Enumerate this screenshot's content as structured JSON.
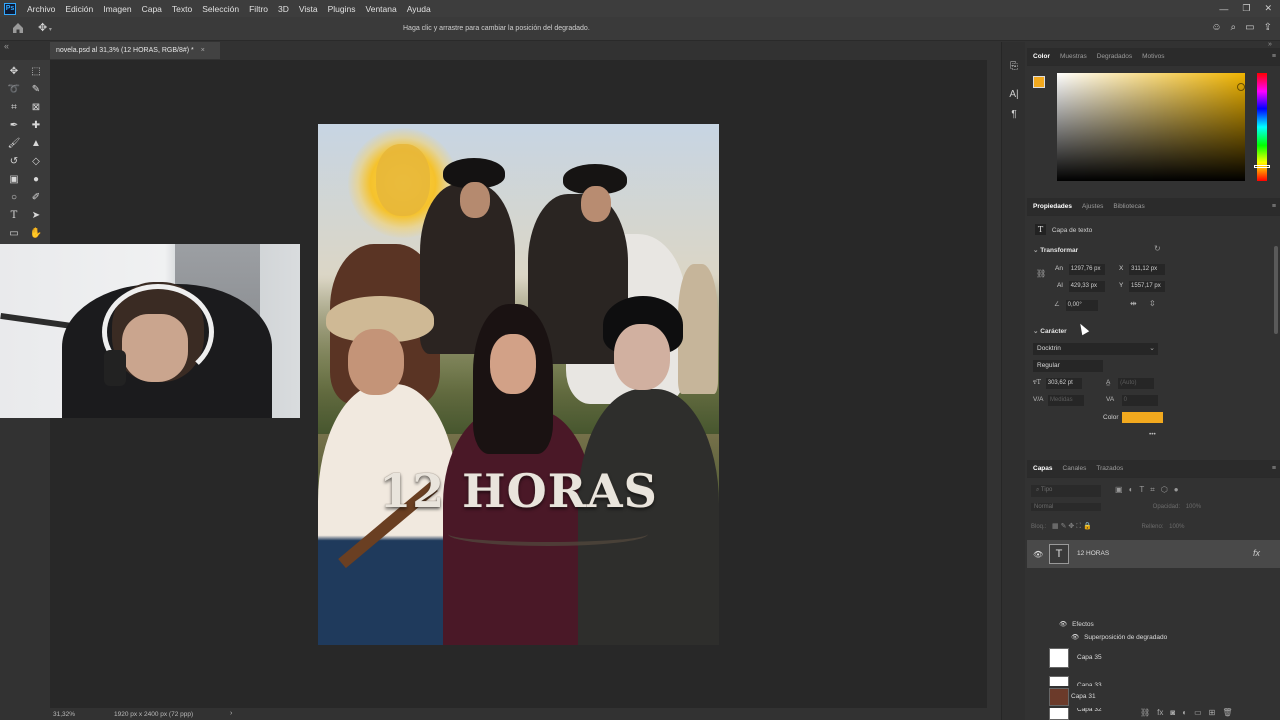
{
  "menu": [
    "Archivo",
    "Edición",
    "Imagen",
    "Capa",
    "Texto",
    "Selección",
    "Filtro",
    "3D",
    "Vista",
    "Plugins",
    "Ventana",
    "Ayuda"
  ],
  "app_logo": "Ps",
  "options_bar": {
    "hint": "Haga clic y arrastre para cambiar la posición del degradado."
  },
  "document": {
    "tab_title": "novela.psd al 31,3% (12 HORAS, RGB/8#) *"
  },
  "poster": {
    "title": "12 HORAS"
  },
  "status": {
    "zoom": "31,32%",
    "size": "1920 px x 2400 px (72 ppp)"
  },
  "color_panel": {
    "tabs": [
      "Color",
      "Muestras",
      "Degradados",
      "Motivos"
    ],
    "foreground": "#f2a91e",
    "background": "#ffffff"
  },
  "properties": {
    "tabs": [
      "Propiedades",
      "Ajustes",
      "Bibliotecas"
    ],
    "layer_type": "Capa de texto",
    "transform_title": "Transformar",
    "an_label": "An",
    "an_value": "1297,76 px",
    "x_label": "X",
    "x_value": "311,12 px",
    "al_label": "Al",
    "al_value": "429,33 px",
    "y_label": "Y",
    "y_value": "1557,17 px",
    "angle_value": "0,00°",
    "character_title": "Carácter",
    "font_family": "Docktrin",
    "font_style": "Regular",
    "font_size": "303,62 pt",
    "leading": "(Auto)",
    "kerning": "Medidas",
    "tracking": "0",
    "color_label": "Color",
    "text_color": "#f2a91e",
    "more": "•••"
  },
  "layers": {
    "tabs": [
      "Capas",
      "Canales",
      "Trazados"
    ],
    "search_placeholder": "Tipo",
    "blend_mode": "Normal",
    "opacity_label": "Opacidad:",
    "opacity_value": "100%",
    "lock_label": "Bloq.:",
    "fill_label": "Relleno:",
    "fill_value": "100%",
    "items": [
      {
        "name": "12 HORAS",
        "fx": "fx"
      },
      {
        "name": "Capa 35"
      },
      {
        "name": "Capa 33"
      },
      {
        "name": "Capa 32"
      },
      {
        "name": "Capa 31"
      }
    ],
    "effects_label": "Efectos",
    "effect_name": "Superposición de degradado"
  }
}
